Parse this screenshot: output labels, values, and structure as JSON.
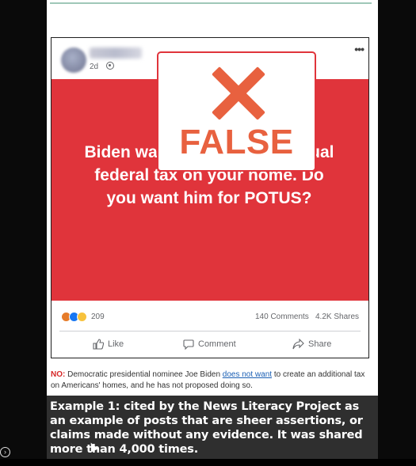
{
  "post": {
    "time": "2d",
    "menu_glyph": "•••",
    "text": "Biden wants to put a 3% annual federal tax on your home. Do you want him for POTUS?",
    "badge": {
      "label": "FALSE",
      "icon": "x-icon",
      "color": "#e8613f"
    },
    "panel_color": "#e0343b",
    "reactions": {
      "icons": [
        "angry-icon",
        "like-icon",
        "wow-icon"
      ],
      "count": "209"
    },
    "comments": "140 Comments",
    "shares": "4.2K Shares",
    "actions": {
      "like": "Like",
      "comment": "Comment",
      "share": "Share"
    }
  },
  "factcheck": {
    "no_label": "NO:",
    "before_link": " Democratic presidential nominee Joe Biden ",
    "link_text": "does not want",
    "after_link": " to create an additional tax on Americans' homes, and he has not proposed doing so."
  },
  "caption": {
    "text": "Example 1: cited by the News Literacy Project as an example of posts that are sheer assertions, or claims made without any evidence. It was shared more than 4,000 times."
  }
}
